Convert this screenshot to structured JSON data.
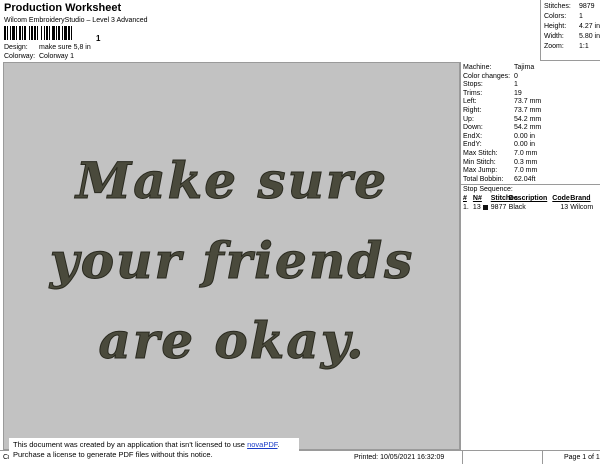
{
  "header": {
    "title": "Production Worksheet",
    "subtitle": "Wilcom EmbroideryStudio – Level 3 Advanced",
    "barcode_number": "1",
    "design_label": "Design:",
    "design_value": "make sure 5,8 in",
    "colorway_label": "Colorway:",
    "colorway_value": "Colorway 1"
  },
  "stats": [
    {
      "label": "Stitches:",
      "value": "9879"
    },
    {
      "label": "Colors:",
      "value": "1"
    },
    {
      "label": "Height:",
      "value": "4.27 in"
    },
    {
      "label": "Width:",
      "value": "5.80 in"
    },
    {
      "label": "Zoom:",
      "value": "1:1"
    }
  ],
  "design": {
    "lines": [
      "Make sure",
      "your friends",
      "are okay."
    ],
    "thread_color": "#4a4a3c",
    "background_color": "#c2c2c2"
  },
  "machine_info": [
    {
      "label": "Machine:",
      "value": "Tajima"
    },
    {
      "label": "Color changes:",
      "value": "0"
    },
    {
      "label": "Stops:",
      "value": "1"
    },
    {
      "label": "Trims:",
      "value": "19"
    },
    {
      "label": "Left:",
      "value": "73.7 mm"
    },
    {
      "label": "Right:",
      "value": "73.7 mm"
    },
    {
      "label": "Up:",
      "value": "54.2 mm"
    },
    {
      "label": "Down:",
      "value": "54.2 mm"
    },
    {
      "label": "EndX:",
      "value": "0.00 in"
    },
    {
      "label": "EndY:",
      "value": "0.00 in"
    },
    {
      "label": "Max Stitch:",
      "value": "7.0 mm"
    },
    {
      "label": "Min Stitch:",
      "value": "0.3 mm"
    },
    {
      "label": "Max Jump:",
      "value": "7.0 mm"
    },
    {
      "label": "Total Bobbin:",
      "value": "62.04ft"
    }
  ],
  "stop_sequence": {
    "title": "Stop Sequence:",
    "columns": [
      "#",
      "N#",
      "",
      "Stitches",
      "Description",
      "Code",
      "Brand"
    ],
    "rows": [
      {
        "num": "1.",
        "n": "13",
        "swatch": "#111111",
        "stitches": "9877",
        "description": "Black",
        "code": "13",
        "brand": "Wilcom"
      }
    ]
  },
  "footer": {
    "left": "Cr",
    "printed": "Printed: 10/05/2021 16:32:09",
    "page": "Page 1 of 1"
  },
  "novapdf": {
    "line1_prefix": "This document was created by an application that isn't licensed to use ",
    "link": "novaPDF",
    "line1_suffix": ".",
    "line2": "Purchase a license to generate PDF files without this notice."
  }
}
